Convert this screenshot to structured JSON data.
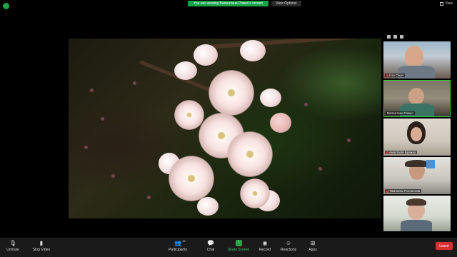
{
  "banner": {
    "message": "You are viewing Валентина Рожко's screen",
    "view_options": "View Options"
  },
  "window": {
    "view_label": "View"
  },
  "participants": [
    {
      "name": "Ігор Сікач",
      "muted": true,
      "active": false
    },
    {
      "name": "Валентина Рожко",
      "muted": false,
      "active": true
    },
    {
      "name": "Анастасія Бражко",
      "muted": true,
      "active": false
    },
    {
      "name": "Тимченко Ростислав",
      "muted": true,
      "active": false
    },
    {
      "name": "",
      "muted": false,
      "active": false
    }
  ],
  "toolbar": {
    "unmute": "Unmute",
    "stop_video": "Stop Video",
    "participants": "Participants",
    "participants_count": "15",
    "chat": "Chat",
    "share_screen": "Share Screen",
    "record": "Record",
    "reactions": "Reactions",
    "apps": "Apps",
    "leave": "Leave"
  },
  "colors": {
    "share_green": "#22a447",
    "leave_red": "#d83030",
    "active_border": "#2ecc40"
  },
  "icons": [
    "shield-icon",
    "microphone-muted-icon",
    "video-camera-icon",
    "participants-icon",
    "chat-icon",
    "share-screen-icon",
    "record-icon",
    "reactions-icon",
    "apps-icon",
    "grid-view-icon"
  ]
}
